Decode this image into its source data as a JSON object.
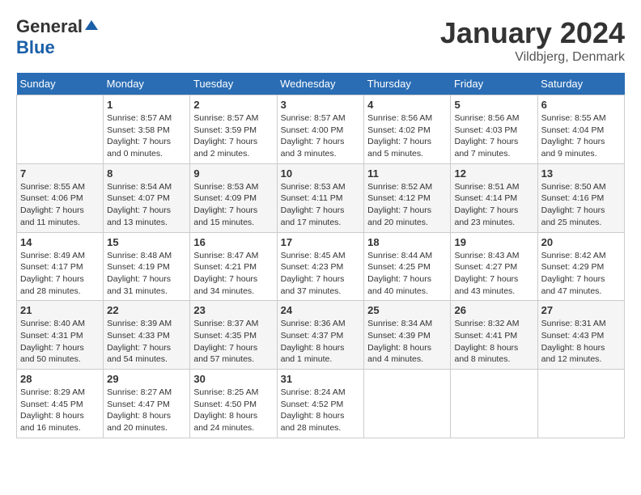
{
  "logo": {
    "general": "General",
    "blue": "Blue"
  },
  "header": {
    "month": "January 2024",
    "location": "Vildbjerg, Denmark"
  },
  "weekdays": [
    "Sunday",
    "Monday",
    "Tuesday",
    "Wednesday",
    "Thursday",
    "Friday",
    "Saturday"
  ],
  "weeks": [
    [
      {
        "day": "",
        "sunrise": "",
        "sunset": "",
        "daylight": ""
      },
      {
        "day": "1",
        "sunrise": "Sunrise: 8:57 AM",
        "sunset": "Sunset: 3:58 PM",
        "daylight": "Daylight: 7 hours and 0 minutes."
      },
      {
        "day": "2",
        "sunrise": "Sunrise: 8:57 AM",
        "sunset": "Sunset: 3:59 PM",
        "daylight": "Daylight: 7 hours and 2 minutes."
      },
      {
        "day": "3",
        "sunrise": "Sunrise: 8:57 AM",
        "sunset": "Sunset: 4:00 PM",
        "daylight": "Daylight: 7 hours and 3 minutes."
      },
      {
        "day": "4",
        "sunrise": "Sunrise: 8:56 AM",
        "sunset": "Sunset: 4:02 PM",
        "daylight": "Daylight: 7 hours and 5 minutes."
      },
      {
        "day": "5",
        "sunrise": "Sunrise: 8:56 AM",
        "sunset": "Sunset: 4:03 PM",
        "daylight": "Daylight: 7 hours and 7 minutes."
      },
      {
        "day": "6",
        "sunrise": "Sunrise: 8:55 AM",
        "sunset": "Sunset: 4:04 PM",
        "daylight": "Daylight: 7 hours and 9 minutes."
      }
    ],
    [
      {
        "day": "7",
        "sunrise": "Sunrise: 8:55 AM",
        "sunset": "Sunset: 4:06 PM",
        "daylight": "Daylight: 7 hours and 11 minutes."
      },
      {
        "day": "8",
        "sunrise": "Sunrise: 8:54 AM",
        "sunset": "Sunset: 4:07 PM",
        "daylight": "Daylight: 7 hours and 13 minutes."
      },
      {
        "day": "9",
        "sunrise": "Sunrise: 8:53 AM",
        "sunset": "Sunset: 4:09 PM",
        "daylight": "Daylight: 7 hours and 15 minutes."
      },
      {
        "day": "10",
        "sunrise": "Sunrise: 8:53 AM",
        "sunset": "Sunset: 4:11 PM",
        "daylight": "Daylight: 7 hours and 17 minutes."
      },
      {
        "day": "11",
        "sunrise": "Sunrise: 8:52 AM",
        "sunset": "Sunset: 4:12 PM",
        "daylight": "Daylight: 7 hours and 20 minutes."
      },
      {
        "day": "12",
        "sunrise": "Sunrise: 8:51 AM",
        "sunset": "Sunset: 4:14 PM",
        "daylight": "Daylight: 7 hours and 23 minutes."
      },
      {
        "day": "13",
        "sunrise": "Sunrise: 8:50 AM",
        "sunset": "Sunset: 4:16 PM",
        "daylight": "Daylight: 7 hours and 25 minutes."
      }
    ],
    [
      {
        "day": "14",
        "sunrise": "Sunrise: 8:49 AM",
        "sunset": "Sunset: 4:17 PM",
        "daylight": "Daylight: 7 hours and 28 minutes."
      },
      {
        "day": "15",
        "sunrise": "Sunrise: 8:48 AM",
        "sunset": "Sunset: 4:19 PM",
        "daylight": "Daylight: 7 hours and 31 minutes."
      },
      {
        "day": "16",
        "sunrise": "Sunrise: 8:47 AM",
        "sunset": "Sunset: 4:21 PM",
        "daylight": "Daylight: 7 hours and 34 minutes."
      },
      {
        "day": "17",
        "sunrise": "Sunrise: 8:45 AM",
        "sunset": "Sunset: 4:23 PM",
        "daylight": "Daylight: 7 hours and 37 minutes."
      },
      {
        "day": "18",
        "sunrise": "Sunrise: 8:44 AM",
        "sunset": "Sunset: 4:25 PM",
        "daylight": "Daylight: 7 hours and 40 minutes."
      },
      {
        "day": "19",
        "sunrise": "Sunrise: 8:43 AM",
        "sunset": "Sunset: 4:27 PM",
        "daylight": "Daylight: 7 hours and 43 minutes."
      },
      {
        "day": "20",
        "sunrise": "Sunrise: 8:42 AM",
        "sunset": "Sunset: 4:29 PM",
        "daylight": "Daylight: 7 hours and 47 minutes."
      }
    ],
    [
      {
        "day": "21",
        "sunrise": "Sunrise: 8:40 AM",
        "sunset": "Sunset: 4:31 PM",
        "daylight": "Daylight: 7 hours and 50 minutes."
      },
      {
        "day": "22",
        "sunrise": "Sunrise: 8:39 AM",
        "sunset": "Sunset: 4:33 PM",
        "daylight": "Daylight: 7 hours and 54 minutes."
      },
      {
        "day": "23",
        "sunrise": "Sunrise: 8:37 AM",
        "sunset": "Sunset: 4:35 PM",
        "daylight": "Daylight: 7 hours and 57 minutes."
      },
      {
        "day": "24",
        "sunrise": "Sunrise: 8:36 AM",
        "sunset": "Sunset: 4:37 PM",
        "daylight": "Daylight: 8 hours and 1 minute."
      },
      {
        "day": "25",
        "sunrise": "Sunrise: 8:34 AM",
        "sunset": "Sunset: 4:39 PM",
        "daylight": "Daylight: 8 hours and 4 minutes."
      },
      {
        "day": "26",
        "sunrise": "Sunrise: 8:32 AM",
        "sunset": "Sunset: 4:41 PM",
        "daylight": "Daylight: 8 hours and 8 minutes."
      },
      {
        "day": "27",
        "sunrise": "Sunrise: 8:31 AM",
        "sunset": "Sunset: 4:43 PM",
        "daylight": "Daylight: 8 hours and 12 minutes."
      }
    ],
    [
      {
        "day": "28",
        "sunrise": "Sunrise: 8:29 AM",
        "sunset": "Sunset: 4:45 PM",
        "daylight": "Daylight: 8 hours and 16 minutes."
      },
      {
        "day": "29",
        "sunrise": "Sunrise: 8:27 AM",
        "sunset": "Sunset: 4:47 PM",
        "daylight": "Daylight: 8 hours and 20 minutes."
      },
      {
        "day": "30",
        "sunrise": "Sunrise: 8:25 AM",
        "sunset": "Sunset: 4:50 PM",
        "daylight": "Daylight: 8 hours and 24 minutes."
      },
      {
        "day": "31",
        "sunrise": "Sunrise: 8:24 AM",
        "sunset": "Sunset: 4:52 PM",
        "daylight": "Daylight: 8 hours and 28 minutes."
      },
      {
        "day": "",
        "sunrise": "",
        "sunset": "",
        "daylight": ""
      },
      {
        "day": "",
        "sunrise": "",
        "sunset": "",
        "daylight": ""
      },
      {
        "day": "",
        "sunrise": "",
        "sunset": "",
        "daylight": ""
      }
    ]
  ]
}
